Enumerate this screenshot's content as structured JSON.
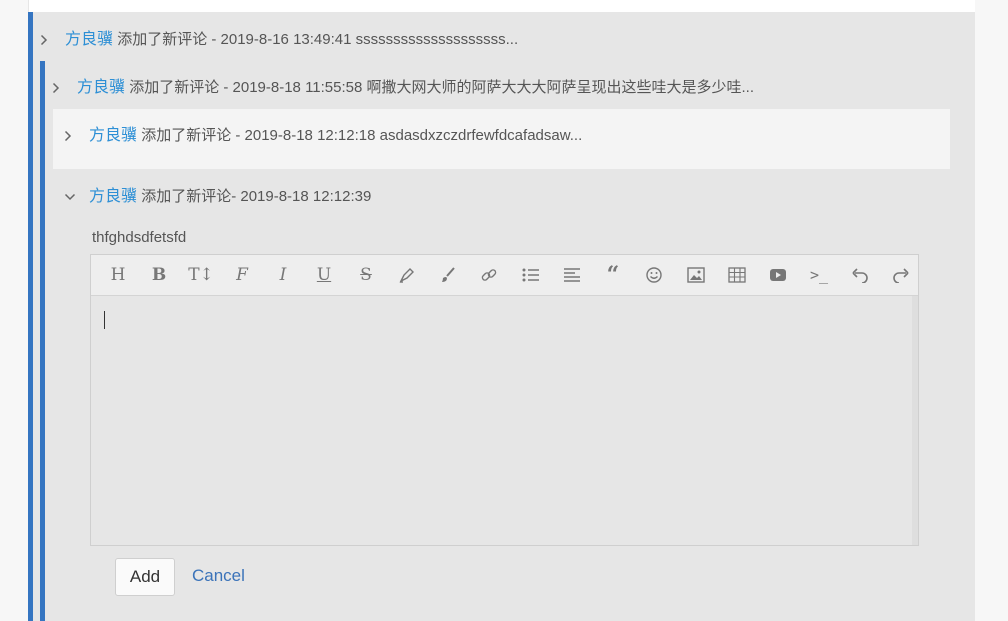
{
  "thread": {
    "items": [
      {
        "author": "方良骥",
        "meta": "添加了新评论 - 2019-8-16 13:49:41 ssssssssssssssssssss...",
        "expanded": false
      },
      {
        "author": "方良骥",
        "meta": "添加了新评论 - 2019-8-18 11:55:58 啊撒大网大师的阿萨大大大阿萨呈现出这些哇大是多少哇...",
        "expanded": false
      },
      {
        "author": "方良骥",
        "meta": "添加了新评论 - 2019-8-18 12:12:18 asdasdxzczdrfewfdcafadsaw...",
        "expanded": false,
        "highlighted": true
      },
      {
        "author": "方良骥",
        "meta": "添加了新评论- 2019-8-18 12:12:39",
        "expanded": true
      }
    ],
    "expanded_body": "thfghdsdfetsfd"
  },
  "editor": {
    "value": "",
    "toolbar": [
      "heading-icon",
      "bold-icon",
      "text-size-icon",
      "font-icon",
      "italic-icon",
      "underline-icon",
      "strikethrough-icon",
      "marker-icon",
      "brush-icon",
      "link-icon",
      "unordered-list-icon",
      "align-icon",
      "quote-icon",
      "emoji-icon",
      "image-icon",
      "table-icon",
      "video-icon",
      "code-icon",
      "undo-icon",
      "redo-icon"
    ]
  },
  "actions": {
    "add_label": "Add",
    "cancel_label": "Cancel"
  },
  "colors": {
    "accent_bar": "#3575c1",
    "author_link": "#2d8fd5",
    "cancel_link": "#3b73b9"
  }
}
